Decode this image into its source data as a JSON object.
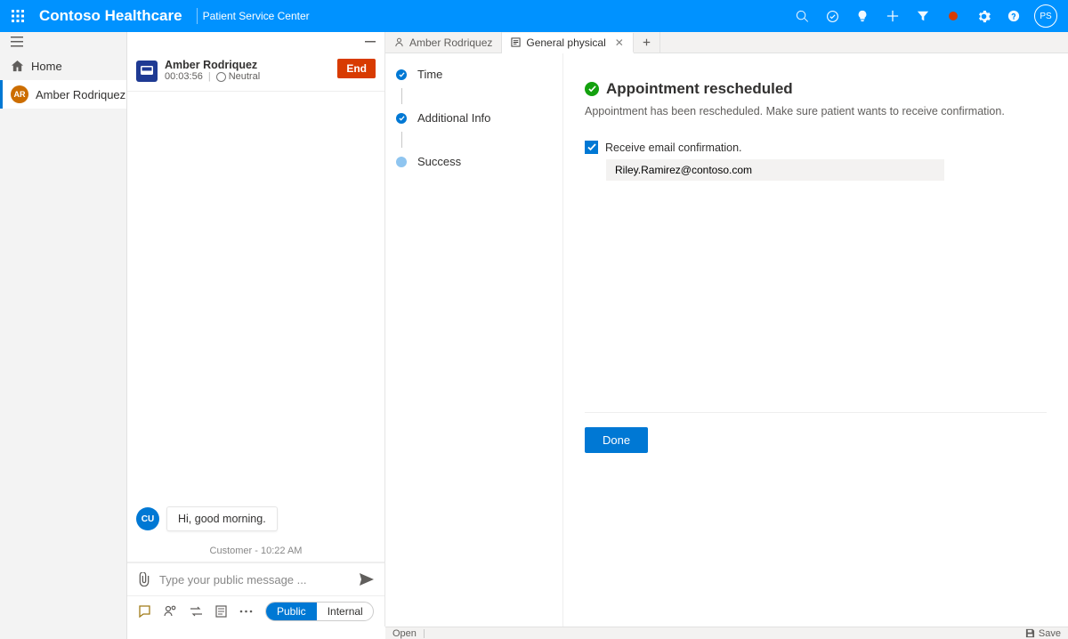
{
  "brand": {
    "name": "Contoso Healthcare",
    "module": "Patient Service Center"
  },
  "user": {
    "initials": "PS"
  },
  "nav": {
    "home": "Home",
    "active": {
      "initials": "AR",
      "label": "Amber Rodriquez"
    }
  },
  "conversation": {
    "name": "Amber Rodriquez",
    "timer": "00:03:56",
    "sentiment": "Neutral",
    "end": "End",
    "message": {
      "initials": "CU",
      "text": "Hi, good morning."
    },
    "timestamp": "Customer - 10:22 AM",
    "compose_placeholder": "Type your public message ...",
    "pill_public": "Public",
    "pill_internal": "Internal"
  },
  "tabs": {
    "t1": "Amber Rodriquez",
    "t2": "General physical"
  },
  "timeline": {
    "s1": "Time",
    "s2": "Additional Info",
    "s3": "Success"
  },
  "form": {
    "title": "Appointment rescheduled",
    "desc": "Appointment has been rescheduled. Make sure patient wants to receive confirmation.",
    "checkbox": "Receive email confirmation.",
    "email": "Riley.Ramirez@contoso.com",
    "done": "Done"
  },
  "status": {
    "open": "Open",
    "save": "Save"
  }
}
